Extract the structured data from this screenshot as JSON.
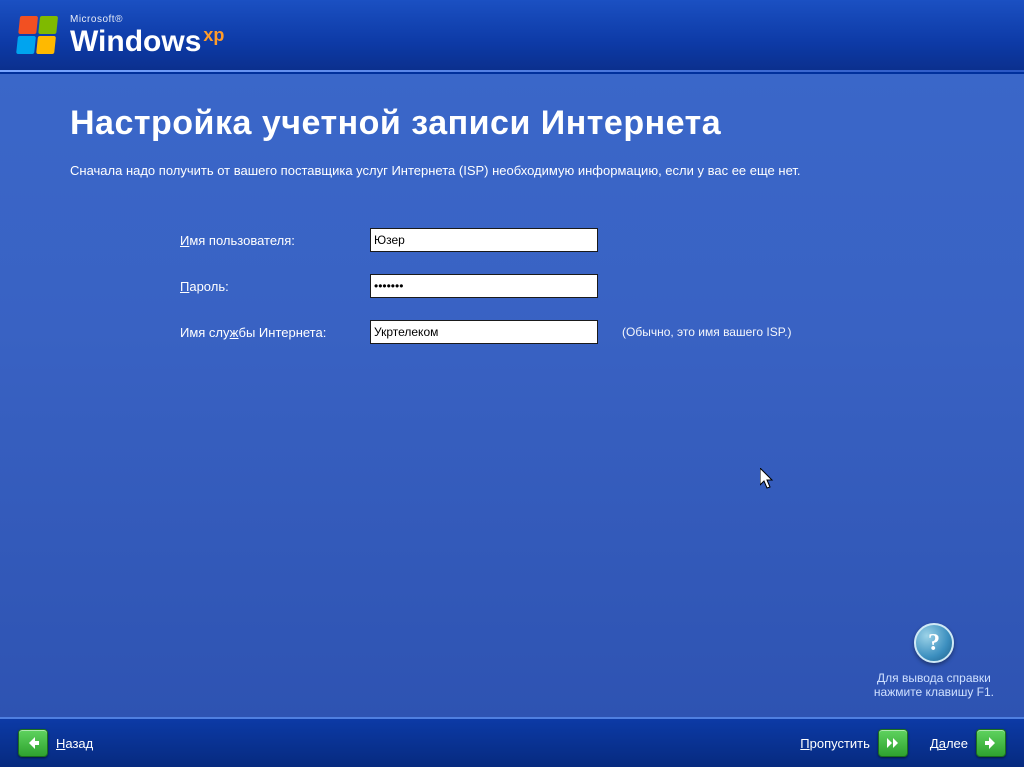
{
  "branding": {
    "company": "Microsoft",
    "trademark": "®",
    "product": "Windows",
    "edition": "xp"
  },
  "page": {
    "title": "Настройка учетной записи Интернета",
    "intro": "Сначала надо получить от вашего поставщика услуг Интернета (ISP) необходимую информацию, если у вас ее еще нет."
  },
  "form": {
    "username": {
      "label_pre": "И",
      "label_rest": "мя пользователя:",
      "value": "Юзер"
    },
    "password": {
      "label_pre": "П",
      "label_rest": "ароль:",
      "value": "•••••••"
    },
    "isp": {
      "label_pre": "Имя слу",
      "label_acc": "ж",
      "label_post": "бы Интернета:",
      "value": "Укртелеком",
      "hint": "(Обычно, это имя вашего ISP.)"
    }
  },
  "help": {
    "line1": "Для вывода справки",
    "line2": "нажмите клавишу F1."
  },
  "nav": {
    "back": {
      "acc": "Н",
      "rest": "азад"
    },
    "skip": {
      "acc": "П",
      "rest": "ропустить"
    },
    "next": {
      "pre": "Д",
      "acc": "а",
      "post": "лее"
    }
  },
  "icons": {
    "help_glyph": "?"
  }
}
